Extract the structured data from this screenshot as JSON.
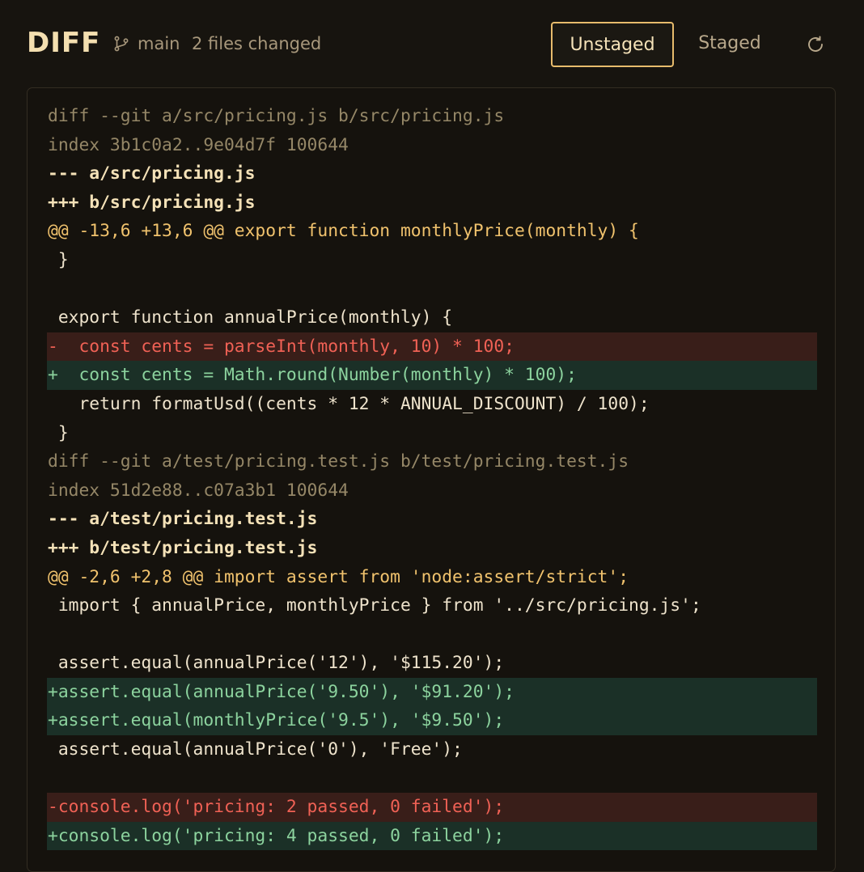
{
  "header": {
    "title": "DIFF",
    "branch": "main",
    "files_changed": "2 files changed",
    "tabs": [
      {
        "label": "Unstaged",
        "active": true
      },
      {
        "label": "Staged",
        "active": false
      }
    ],
    "icons": {
      "branch": "git-branch-icon",
      "refresh": "refresh-icon"
    }
  },
  "colors": {
    "background": "#17140f",
    "accent": "#e7bb6c",
    "added_text": "#8cd39e",
    "added_bg": "#1b3027",
    "removed_text": "#f06155",
    "removed_bg": "#391e19",
    "hunk_header": "#f0c26d",
    "meta_text": "#958767"
  },
  "diff": {
    "lines": [
      {
        "type": "meta",
        "text": "diff --git a/src/pricing.js b/src/pricing.js"
      },
      {
        "type": "meta",
        "text": "index 3b1c0a2..9e04d7f 100644"
      },
      {
        "type": "file",
        "text": "--- a/src/pricing.js"
      },
      {
        "type": "file",
        "text": "+++ b/src/pricing.js"
      },
      {
        "type": "hunk",
        "text": "@@ -13,6 +13,6 @@ export function monthlyPrice(monthly) {"
      },
      {
        "type": "context",
        "text": " }"
      },
      {
        "type": "context",
        "text": " "
      },
      {
        "type": "context",
        "text": " export function annualPrice(monthly) {"
      },
      {
        "type": "del",
        "text": "-  const cents = parseInt(monthly, 10) * 100;"
      },
      {
        "type": "add",
        "text": "+  const cents = Math.round(Number(monthly) * 100);"
      },
      {
        "type": "context",
        "text": "   return formatUsd((cents * 12 * ANNUAL_DISCOUNT) / 100);"
      },
      {
        "type": "context",
        "text": " }"
      },
      {
        "type": "meta",
        "text": "diff --git a/test/pricing.test.js b/test/pricing.test.js"
      },
      {
        "type": "meta",
        "text": "index 51d2e88..c07a3b1 100644"
      },
      {
        "type": "file",
        "text": "--- a/test/pricing.test.js"
      },
      {
        "type": "file",
        "text": "+++ b/test/pricing.test.js"
      },
      {
        "type": "hunk",
        "text": "@@ -2,6 +2,8 @@ import assert from 'node:assert/strict';"
      },
      {
        "type": "context",
        "text": " import { annualPrice, monthlyPrice } from '../src/pricing.js';"
      },
      {
        "type": "context",
        "text": " "
      },
      {
        "type": "context",
        "text": " assert.equal(annualPrice('12'), '$115.20');"
      },
      {
        "type": "add",
        "text": "+assert.equal(annualPrice('9.50'), '$91.20');"
      },
      {
        "type": "add",
        "text": "+assert.equal(monthlyPrice('9.5'), '$9.50');"
      },
      {
        "type": "context",
        "text": " assert.equal(annualPrice('0'), 'Free');"
      },
      {
        "type": "context",
        "text": " "
      },
      {
        "type": "del",
        "text": "-console.log('pricing: 2 passed, 0 failed');"
      },
      {
        "type": "add",
        "text": "+console.log('pricing: 4 passed, 0 failed');"
      }
    ]
  }
}
